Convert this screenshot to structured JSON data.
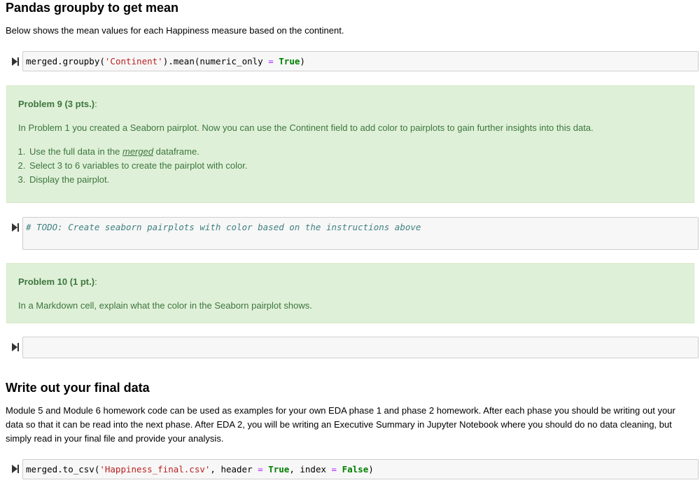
{
  "section1": {
    "heading": "Pandas groupby to get mean",
    "description": "Below shows the mean values for each Happiness measure based on the continent.",
    "code": {
      "prefix": "merged.groupby(",
      "str1": "'Continent'",
      "mid": ").mean(numeric_only ",
      "op": "=",
      "kw": "True",
      "suffix": ")"
    }
  },
  "problem9": {
    "title": "Problem 9 (3 pts.)",
    "colon": ":",
    "intro": "In Problem 1 you created a Seaborn pairplot. Now you can use the Continent field to add color to pairplots to gain further insights into this data.",
    "steps": [
      {
        "before": "Use the full data in the ",
        "em": "merged",
        "after": " dataframe."
      },
      {
        "text": "Select 3 to 6 variables to create the pairplot with color."
      },
      {
        "text": "Display the pairplot."
      }
    ]
  },
  "todo_cell": {
    "comment": "# TODO: Create seaborn pairplots with color based on the instructions above"
  },
  "problem10": {
    "title": "Problem 10 (1 pt.)",
    "colon": ":",
    "intro": "In a Markdown cell, explain what the color in the Seaborn pairplot shows."
  },
  "section2": {
    "heading": "Write out your final data",
    "description": "Module 5 and Module 6 homework code can be used as examples for your own EDA phase 1 and phase 2 homework. After each phase you should be writing out your data so that it can be read into the next phase. After EDA 2, you will be writing an Executive Summary in Jupyter Notebook where you should do no data cleaning, but simply read in your final file and provide your analysis.",
    "code": {
      "prefix": "merged.to_csv(",
      "str1": "'Happiness_final.csv'",
      "mid1": ", header ",
      "op1": "=",
      "kw1": "True",
      "mid2": ", index ",
      "op2": "=",
      "kw2": "False",
      "suffix": ")"
    }
  },
  "icons": {
    "run": "run-cell-icon"
  }
}
